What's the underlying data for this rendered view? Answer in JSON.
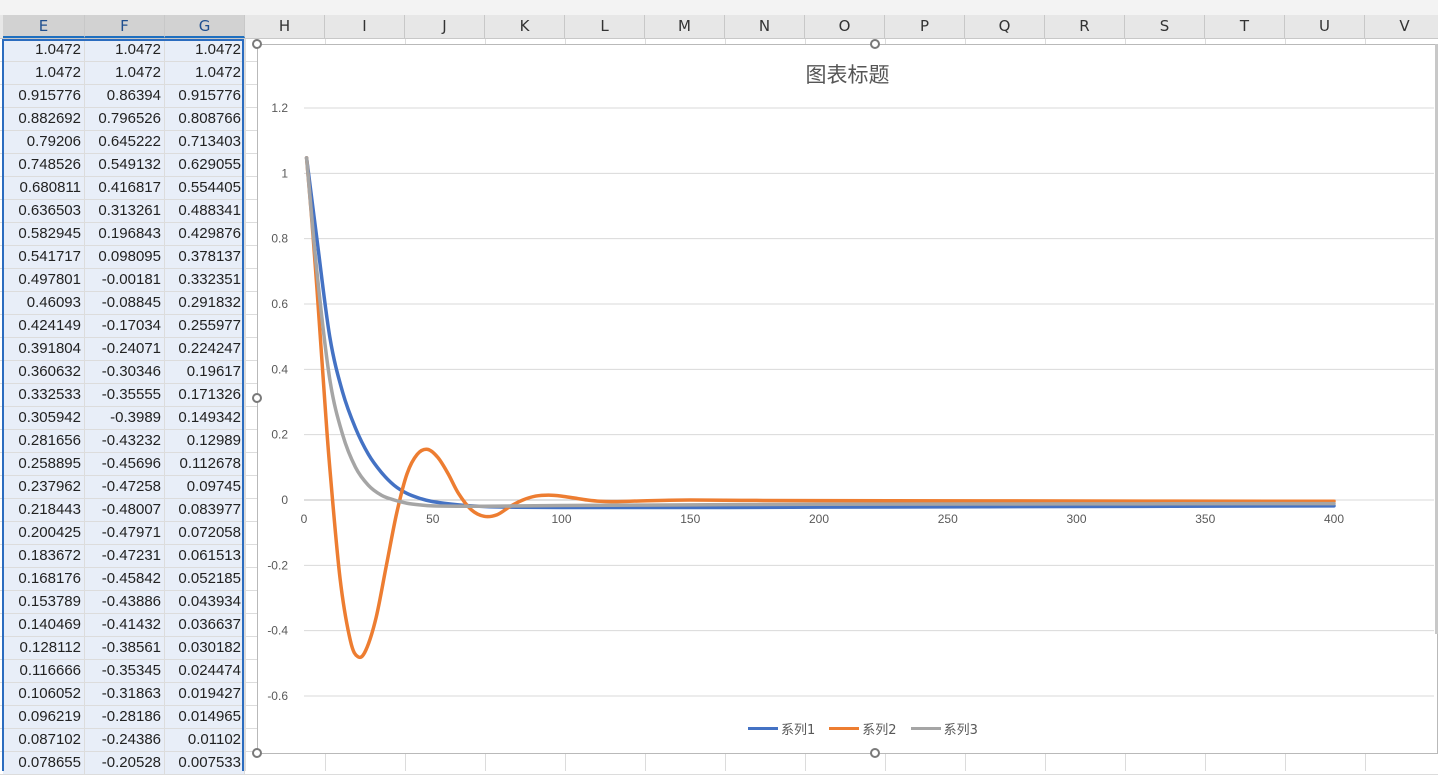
{
  "columns": [
    "E",
    "F",
    "G",
    "H",
    "I",
    "J",
    "K",
    "L",
    "M",
    "N",
    "O",
    "P",
    "Q",
    "R",
    "S",
    "T",
    "U",
    "V"
  ],
  "rows": [
    [
      "1.0472",
      "1.0472",
      "1.0472"
    ],
    [
      "1.0472",
      "1.0472",
      "1.0472"
    ],
    [
      "0.915776",
      "0.86394",
      "0.915776"
    ],
    [
      "0.882692",
      "0.796526",
      "0.808766"
    ],
    [
      "0.79206",
      "0.645222",
      "0.713403"
    ],
    [
      "0.748526",
      "0.549132",
      "0.629055"
    ],
    [
      "0.680811",
      "0.416817",
      "0.554405"
    ],
    [
      "0.636503",
      "0.313261",
      "0.488341"
    ],
    [
      "0.582945",
      "0.196843",
      "0.429876"
    ],
    [
      "0.541717",
      "0.098095",
      "0.378137"
    ],
    [
      "0.497801",
      "-0.00181",
      "0.332351"
    ],
    [
      "0.46093",
      "-0.08845",
      "0.291832"
    ],
    [
      "0.424149",
      "-0.17034",
      "0.255977"
    ],
    [
      "0.391804",
      "-0.24071",
      "0.224247"
    ],
    [
      "0.360632",
      "-0.30346",
      "0.19617"
    ],
    [
      "0.332533",
      "-0.35555",
      "0.171326"
    ],
    [
      "0.305942",
      "-0.3989",
      "0.149342"
    ],
    [
      "0.281656",
      "-0.43232",
      "0.12989"
    ],
    [
      "0.258895",
      "-0.45696",
      "0.112678"
    ],
    [
      "0.237962",
      "-0.47258",
      "0.09745"
    ],
    [
      "0.218443",
      "-0.48007",
      "0.083977"
    ],
    [
      "0.200425",
      "-0.47971",
      "0.072058"
    ],
    [
      "0.183672",
      "-0.47231",
      "0.061513"
    ],
    [
      "0.168176",
      "-0.45842",
      "0.052185"
    ],
    [
      "0.153789",
      "-0.43886",
      "0.043934"
    ],
    [
      "0.140469",
      "-0.41432",
      "0.036637"
    ],
    [
      "0.128112",
      "-0.38561",
      "0.030182"
    ],
    [
      "0.116666",
      "-0.35345",
      "0.024474"
    ],
    [
      "0.106052",
      "-0.31863",
      "0.019427"
    ],
    [
      "0.096219",
      "-0.28186",
      "0.014965"
    ],
    [
      "0.087102",
      "-0.24386",
      "0.01102"
    ],
    [
      "0.078655",
      "-0.20528",
      "0.007533"
    ]
  ],
  "chart_data": {
    "type": "line",
    "title": "图表标题",
    "xlabel": "",
    "ylabel": "",
    "xlim": [
      0,
      400
    ],
    "ylim": [
      -0.6,
      1.2
    ],
    "x_ticks": [
      "0",
      "50",
      "100",
      "150",
      "200",
      "250",
      "300",
      "350",
      "400"
    ],
    "y_ticks": [
      "1.2",
      "1",
      "0.8",
      "0.6",
      "0.4",
      "0.2",
      "0",
      "-0.2",
      "-0.4",
      "-0.6"
    ],
    "grid": true,
    "legend_position": "bottom",
    "series": [
      {
        "name": "系列1",
        "color": "#4472c4",
        "x": [
          1,
          5,
          10,
          15,
          20,
          25,
          30,
          35,
          40,
          45,
          50,
          60,
          70,
          80,
          100,
          150,
          200,
          300,
          400
        ],
        "y": [
          1.0472,
          0.8,
          0.5,
          0.33,
          0.22,
          0.14,
          0.085,
          0.045,
          0.02,
          0.005,
          -0.005,
          -0.015,
          -0.02,
          -0.022,
          -0.023,
          -0.023,
          -0.022,
          -0.02,
          -0.018
        ]
      },
      {
        "name": "系列2",
        "color": "#ed7d31",
        "x": [
          1,
          3,
          5,
          8,
          10,
          14,
          18,
          21,
          24,
          28,
          32,
          36,
          40,
          44,
          48,
          52,
          56,
          60,
          65,
          70,
          75,
          80,
          85,
          90,
          95,
          100,
          105,
          110,
          115,
          120,
          130,
          140,
          150,
          170,
          200,
          300,
          400
        ],
        "y": [
          1.0472,
          0.86,
          0.65,
          0.31,
          0.1,
          -0.24,
          -0.43,
          -0.48,
          -0.46,
          -0.36,
          -0.2,
          -0.04,
          0.08,
          0.14,
          0.155,
          0.13,
          0.08,
          0.02,
          -0.03,
          -0.05,
          -0.045,
          -0.02,
          0.0,
          0.012,
          0.015,
          0.012,
          0.006,
          0.0,
          -0.004,
          -0.005,
          -0.003,
          -0.001,
          0.0,
          -0.001,
          -0.002,
          -0.003,
          -0.004
        ]
      },
      {
        "name": "系列3",
        "color": "#a5a5a5",
        "x": [
          1,
          5,
          10,
          15,
          20,
          25,
          30,
          35,
          40,
          45,
          50,
          60,
          70,
          100,
          150,
          200,
          300,
          400
        ],
        "y": [
          1.0472,
          0.7,
          0.37,
          0.2,
          0.1,
          0.045,
          0.015,
          0.0,
          -0.01,
          -0.015,
          -0.018,
          -0.019,
          -0.019,
          -0.017,
          -0.015,
          -0.013,
          -0.012,
          -0.011
        ]
      }
    ]
  }
}
